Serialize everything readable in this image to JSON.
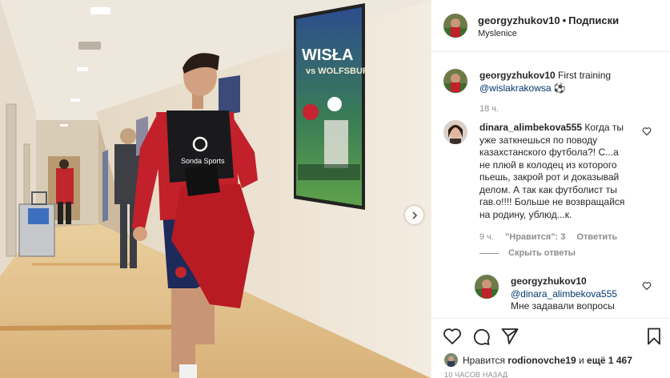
{
  "post": {
    "author": "georgyzhukov10",
    "follow_label": "Подписки",
    "location": "Myslenice",
    "caption_text": "First training",
    "caption_mention": "@wislakrakowsa",
    "caption_emoji": "⚽",
    "caption_time": "18 ч."
  },
  "photo": {
    "poster_title_line1": "WISŁA",
    "poster_title_line2": "vs WOLFSBURG",
    "vest_brand": "Sonda Sports"
  },
  "comments": [
    {
      "user": "dinara_alimbekova555",
      "text_lines": [
        "Когда ты",
        "уже заткнешься по поводу",
        "казахстанского футбола?! С...а",
        "не плюй в колодец из которого",
        "пьешь, закрой рот и доказывай",
        "делом. А так как футболист ты",
        "гав.о!!!! Больше не возвращайся",
        "на родину, ублюд...к."
      ],
      "time": "9 ч.",
      "likes": "\"Нравится\": 3",
      "reply_label": "Ответить",
      "hide_replies_label": "Скрыть ответы"
    }
  ],
  "reply": {
    "user": "georgyzhukov10",
    "mention": "@dinara_alimbekova555",
    "text": "Мне задавали вопросы"
  },
  "likes_bar": {
    "prefix": "Нравится",
    "liker": "rodionovche19",
    "and_text": "и",
    "count_text": "ещё 1 467"
  },
  "timestamp": "10 ЧАСОВ НАЗАД"
}
